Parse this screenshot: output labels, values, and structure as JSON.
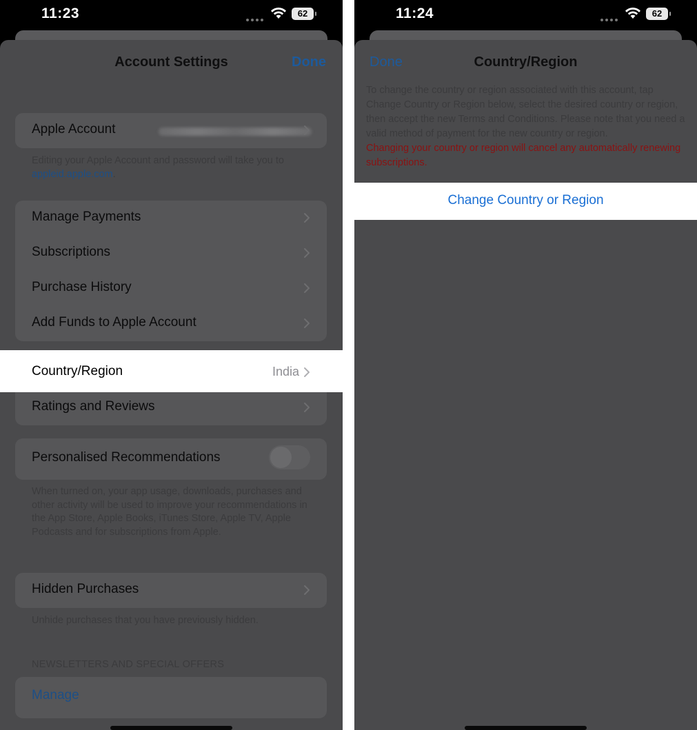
{
  "left": {
    "status": {
      "time": "11:23",
      "battery": "62"
    },
    "nav": {
      "title": "Account Settings",
      "done": "Done"
    },
    "apple_account": {
      "label": "Apple Account"
    },
    "apple_account_note": {
      "text": "Editing your Apple Account and password will take you to",
      "link": "appleid.apple.com",
      "suffix": "."
    },
    "menu": [
      {
        "label": "Manage Payments"
      },
      {
        "label": "Subscriptions"
      },
      {
        "label": "Purchase History"
      },
      {
        "label": "Add Funds to Apple Account"
      }
    ],
    "country": {
      "label": "Country/Region",
      "value": "India"
    },
    "ratings": {
      "label": "Ratings and Reviews"
    },
    "personalised": {
      "label": "Personalised Recommendations",
      "toggle_on": false
    },
    "personalised_note": "When turned on, your app usage, downloads, purchases and other activity will be used to improve your recommendations in the App Store, Apple Books, iTunes Store, Apple TV, Apple Podcasts and for subscriptions from Apple.",
    "hidden": {
      "label": "Hidden Purchases"
    },
    "hidden_note": "Unhide purchases that you have previously hidden.",
    "newsletters": {
      "header": "NEWSLETTERS AND SPECIAL OFFERS",
      "manage": "Manage"
    }
  },
  "right": {
    "status": {
      "time": "11:24",
      "battery": "62"
    },
    "nav": {
      "title": "Country/Region",
      "done": "Done"
    },
    "description": "To change the country or region associated with this account, tap Change Country or Region below, select the desired country or region, then accept the new Terms and Conditions. Please note that you need a valid method of payment for the new country or region.",
    "warning": "Changing your country or region will cancel any automatically renewing subscriptions.",
    "change_button": "Change Country or Region"
  },
  "colors": {
    "accent": "#1a6fd4",
    "warning": "#b3261e",
    "dim_overlay": "#4a4a4c"
  }
}
